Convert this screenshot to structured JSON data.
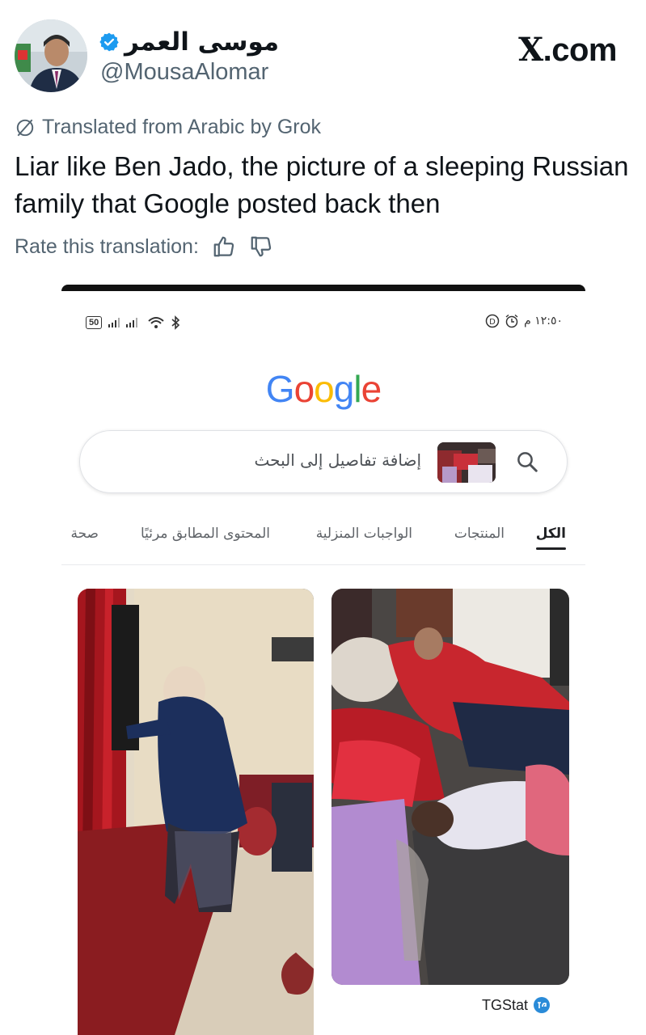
{
  "tweet": {
    "display_name": "موسى العمر",
    "handle": "@MousaAlomar",
    "brand": "X.com",
    "translated_label": "Translated from Arabic by Grok",
    "text": "Liar like Ben Jado, the picture of a sleeping Russian family that Google posted back then",
    "rate_label": "Rate this translation:"
  },
  "screenshot": {
    "status": {
      "battery": "50",
      "time": "١٢:٥٠ م"
    },
    "search": {
      "placeholder": "إضافة تفاصيل إلى البحث"
    },
    "tabs": [
      {
        "label": "الكل",
        "active": true
      },
      {
        "label": "المنتجات",
        "active": false
      },
      {
        "label": "الواجبات المنزلية",
        "active": false
      },
      {
        "label": "المحتوى المطابق مرئيًا",
        "active": false
      },
      {
        "label": "صحة",
        "active": false
      }
    ],
    "result_source": "TGStat"
  },
  "colors": {
    "text_primary": "#0f1419",
    "text_secondary": "#536471",
    "verified_blue": "#1d9bf0",
    "google_blue": "#4285F4",
    "google_red": "#EA4335",
    "google_yellow": "#FBBC05",
    "google_green": "#34A853"
  },
  "icons": [
    "verified-badge-icon",
    "grok-translate-icon",
    "thumbs-up-icon",
    "thumbs-down-icon",
    "search-icon",
    "wifi-icon",
    "bluetooth-icon",
    "alarm-icon",
    "tgstat-icon"
  ]
}
